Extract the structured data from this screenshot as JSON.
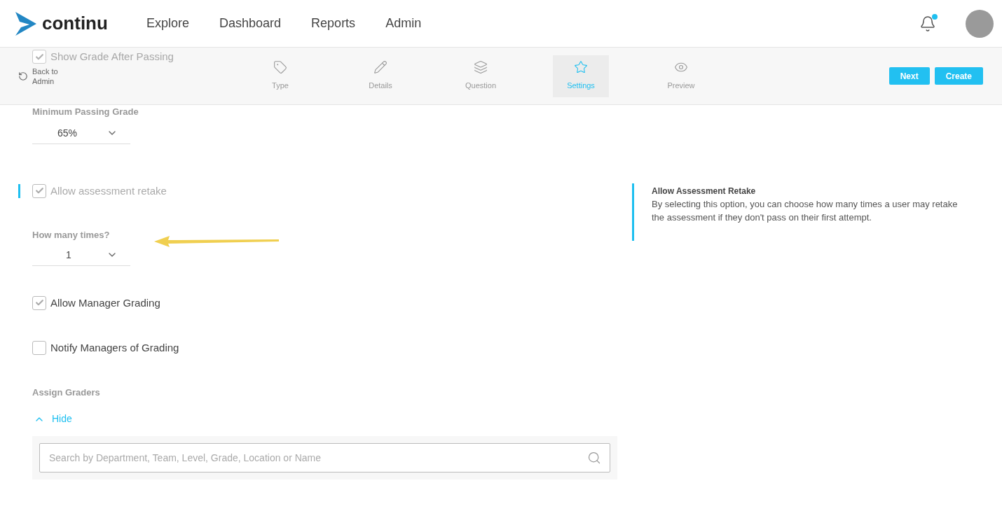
{
  "header": {
    "logo": "continu",
    "nav": [
      {
        "label": "Explore"
      },
      {
        "label": "Dashboard"
      },
      {
        "label": "Reports"
      },
      {
        "label": "Admin"
      }
    ],
    "notifications": {
      "unread": true
    }
  },
  "toolbar": {
    "faded_option": {
      "label": "Show Grade After Passing",
      "checked": true
    },
    "back": "Back to Admin",
    "steps": [
      {
        "label": "Type",
        "selected": false
      },
      {
        "label": "Details",
        "selected": false
      },
      {
        "label": "Question",
        "selected": false
      },
      {
        "label": "Settings",
        "selected": true
      },
      {
        "label": "Preview",
        "selected": false
      }
    ],
    "buttons": [
      "Next",
      "Create"
    ]
  },
  "form": {
    "min_grade": {
      "label": "Minimum Passing Grade",
      "value": "65%"
    },
    "retake": {
      "label": "Allow assessment retake",
      "checked": true,
      "disabled": true,
      "highlighted": true
    },
    "times": {
      "label": "How many times?",
      "value": "1"
    },
    "options": [
      {
        "label": "Allow Manager Grading",
        "checked": true,
        "disabled": false
      },
      {
        "label": "Notify Managers of Grading",
        "checked": false,
        "disabled": false
      }
    ],
    "graders": {
      "label": "Assign Graders",
      "toggle": "Hide",
      "expanded": true,
      "search_placeholder": "Search by Department, Team, Level, Grade, Location or Name"
    }
  },
  "help": {
    "title": "Allow Assessment Retake",
    "text": "By selecting this option, you can choose how many times a user may retake the assessment if they don't pass on their first attempt."
  }
}
